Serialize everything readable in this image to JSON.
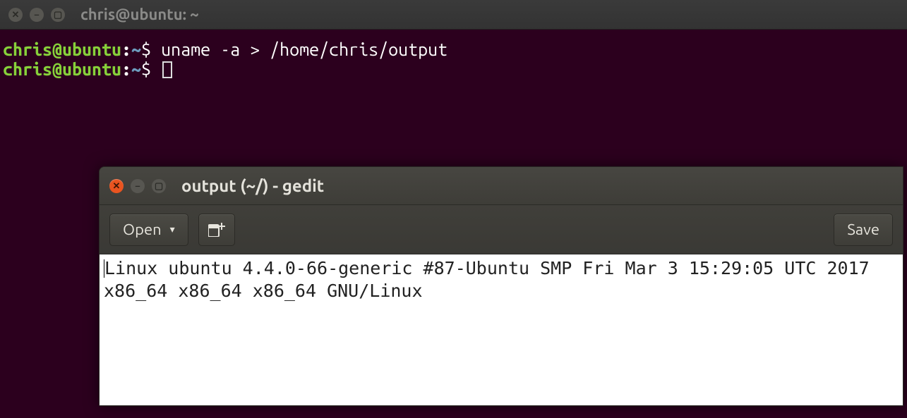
{
  "terminal": {
    "title": "chris@ubuntu: ~",
    "prompt_user": "chris@ubuntu",
    "prompt_sep": ":",
    "prompt_path": "~",
    "prompt_sym": "$",
    "lines": [
      {
        "cmd": " uname -a > /home/chris/output"
      },
      {
        "cmd": " "
      }
    ]
  },
  "gedit": {
    "title": "output (~/) - gedit",
    "toolbar": {
      "open_label": "Open",
      "save_label": "Save",
      "newtab_icon": "new-tab-icon"
    },
    "content": "Linux ubuntu 4.4.0-66-generic #87-Ubuntu SMP Fri Mar 3 15:29:05 UTC 2017 x86_64 x86_64 x86_64 GNU/Linux"
  },
  "icons": {
    "close_glyph": "✕",
    "min_glyph": "–",
    "max_glyph": "▢",
    "caret_down": "▾"
  }
}
